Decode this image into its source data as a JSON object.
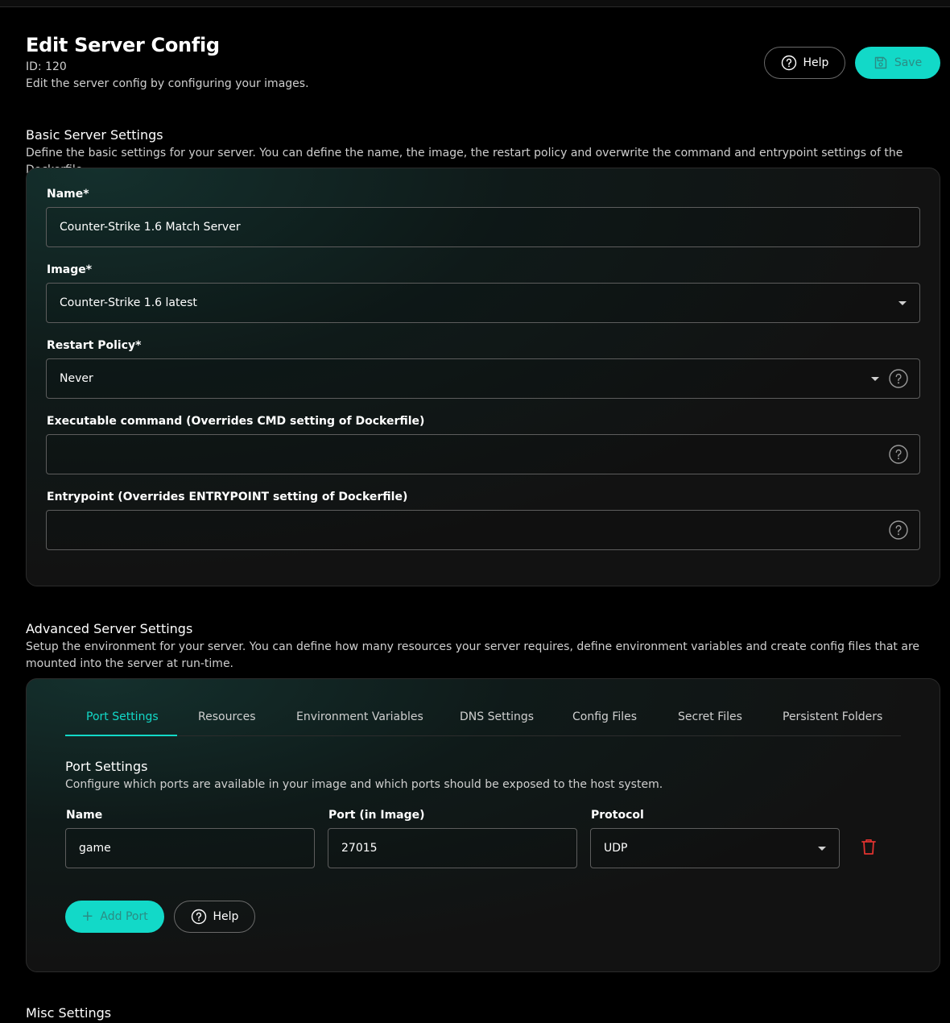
{
  "header": {
    "title": "Edit Server Config",
    "id_text": "ID: 120",
    "subtitle": "Edit the server config by configuring your images.",
    "help_label": "Help",
    "save_label": "Save"
  },
  "basic": {
    "title": "Basic Server Settings",
    "description": "Define the basic settings for your server. You can define the name, the image, the restart policy and overwrite the command and entrypoint settings of the Dockerfile.",
    "name_label": "Name*",
    "name_value": "Counter-Strike 1.6 Match Server",
    "image_label": "Image*",
    "image_value": "Counter-Strike 1.6 latest",
    "restart_label": "Restart Policy*",
    "restart_value": "Never",
    "command_label": "Executable command (Overrides CMD setting of Dockerfile)",
    "command_value": "",
    "entrypoint_label": "Entrypoint (Overrides ENTRYPOINT setting of Dockerfile)",
    "entrypoint_value": ""
  },
  "advanced": {
    "title": "Advanced Server Settings",
    "description": "Setup the environment for your server. You can define how many resources your server requires, define environment variables and create config files that are mounted into the server at run-time.",
    "tabs": [
      "Port Settings",
      "Resources",
      "Environment Variables",
      "DNS Settings",
      "Config Files",
      "Secret Files",
      "Persistent Folders"
    ],
    "active_tab": "Port Settings",
    "port_section_title": "Port Settings",
    "port_section_desc": "Configure which ports are available in your image and which ports should be exposed to the host system.",
    "col_name": "Name",
    "col_port": "Port (in Image)",
    "col_protocol": "Protocol",
    "ports": [
      {
        "name": "game",
        "port": "27015",
        "protocol": "UDP"
      }
    ],
    "add_port_label": "Add Port",
    "help_label": "Help"
  },
  "misc": {
    "title": "Misc Settings"
  },
  "colors": {
    "accent": "#12d9c8",
    "danger": "#e0322f",
    "background": "#000000"
  },
  "icons": [
    "help-icon",
    "save-icon",
    "dropdown-caret-icon",
    "question-icon",
    "trash-icon",
    "plus-icon"
  ]
}
